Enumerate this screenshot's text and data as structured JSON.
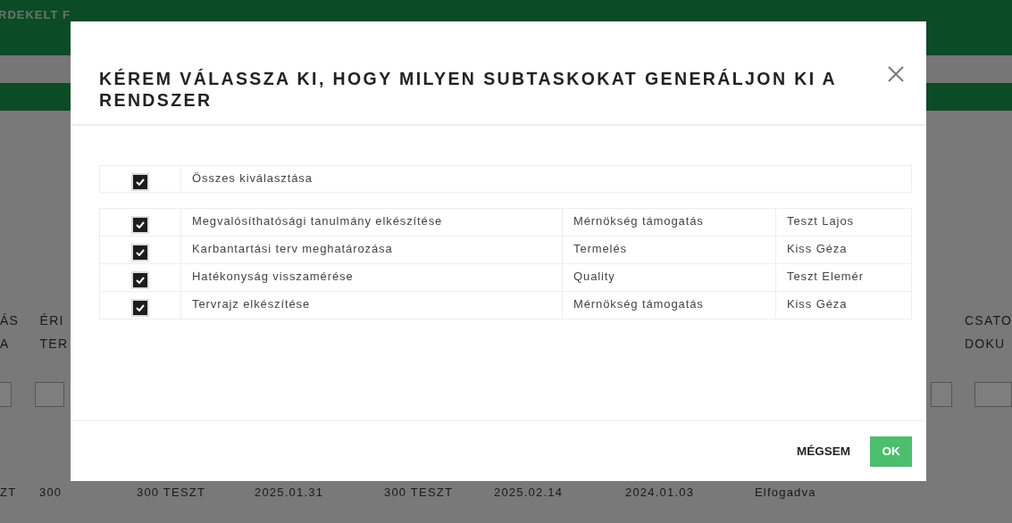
{
  "background": {
    "nav_items": [
      "RDEKELT F"
    ],
    "table": {
      "headers": [
        {
          "lines": [
            "ÁS",
            "A"
          ]
        },
        {
          "lines": [
            "ÉRI",
            "TER"
          ]
        },
        {
          "lines": [
            "CSATO",
            "DOKU"
          ]
        }
      ],
      "row": [
        "ZT",
        "300",
        "300 TESZT",
        "2025.01.31",
        "300 TESZT",
        "2025.02.14",
        "2024.01.03",
        "Elfogadva"
      ]
    }
  },
  "dialog": {
    "title": "KÉREM VÁLASSZA KI, HOGY MILYEN SUBTASKOKAT GENERÁLJON KI A RENDSZER",
    "select_all": {
      "label": "Összes kiválasztása",
      "checked": true
    },
    "subtasks": [
      {
        "name": "Megvalósíthatósági tanulmány elkészítése",
        "department": "Mérnökség támogatás",
        "assignee": "Teszt Lajos",
        "checked": true
      },
      {
        "name": "Karbantartási terv meghatározása",
        "department": "Termelés",
        "assignee": "Kiss Géza",
        "checked": true
      },
      {
        "name": "Hatékonyság visszamérése",
        "department": "Quality",
        "assignee": "Teszt Elemér",
        "checked": true
      },
      {
        "name": "Tervrajz elkészítése",
        "department": "Mérnökség támogatás",
        "assignee": "Kiss Géza",
        "checked": true
      }
    ],
    "buttons": [
      {
        "label": "MÉGSEM",
        "kind": "cancel"
      },
      {
        "label": "OK",
        "kind": "primary"
      }
    ]
  }
}
